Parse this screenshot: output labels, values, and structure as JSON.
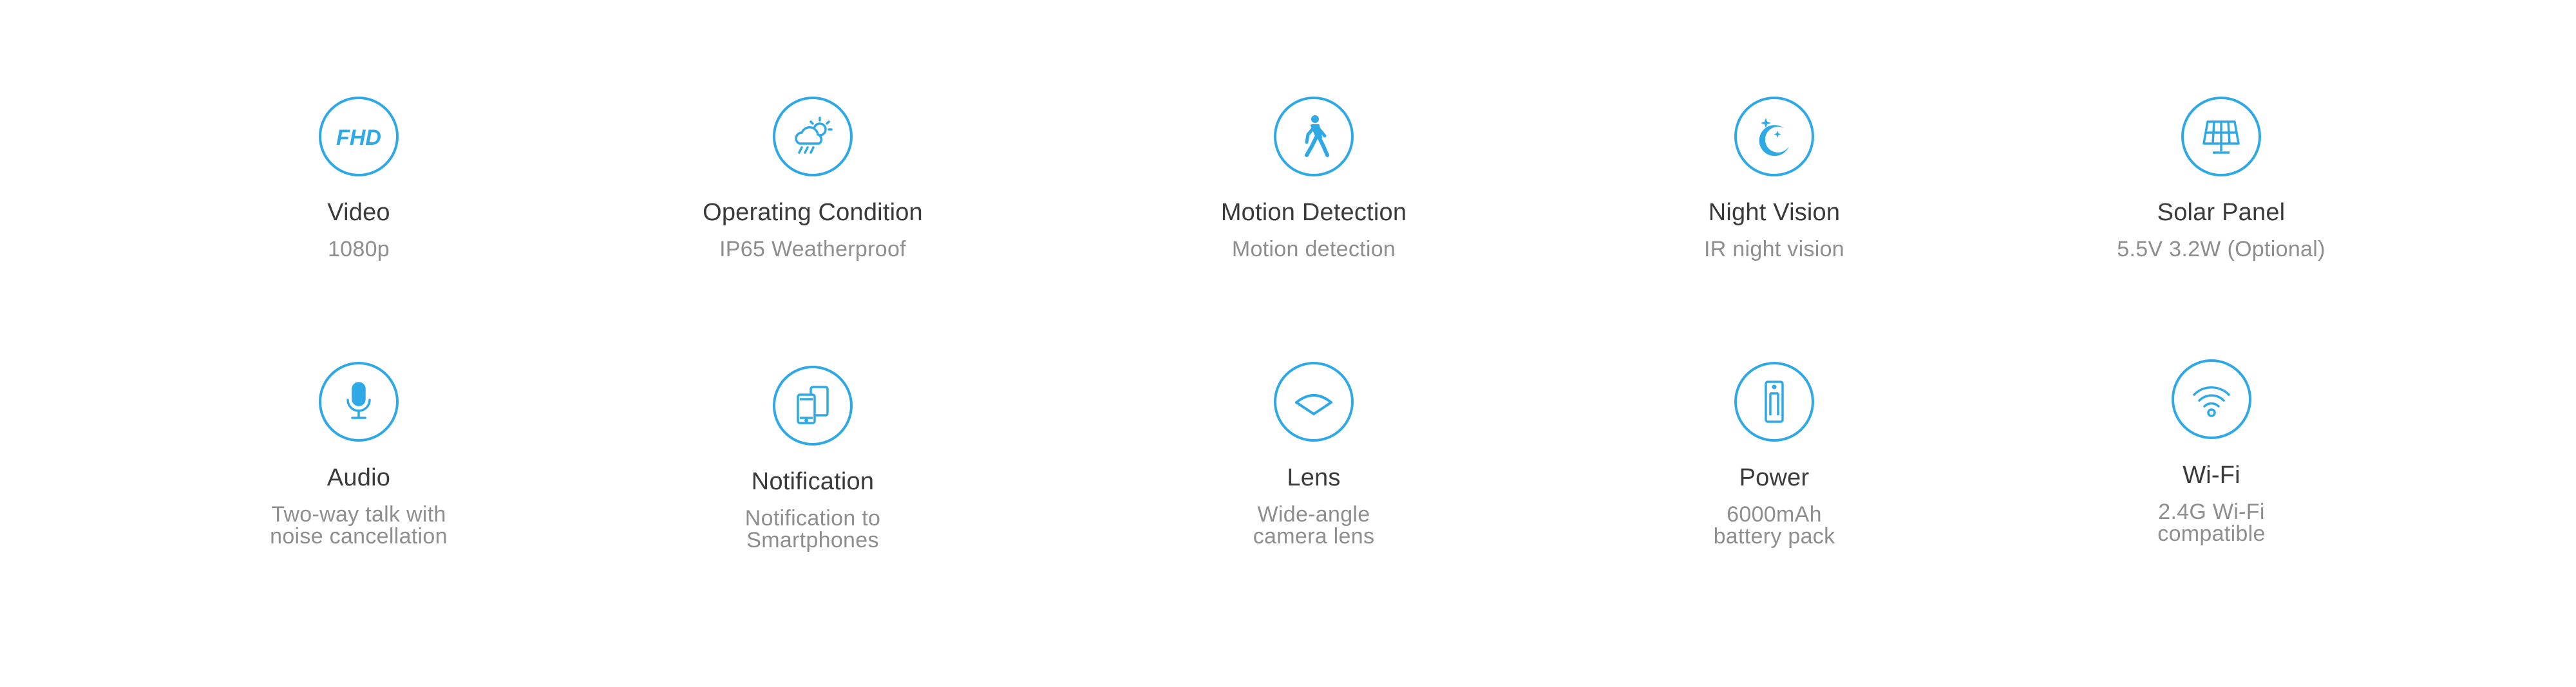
{
  "theme": {
    "accent": "#2fa9e6",
    "title_color": "#3a3a3a",
    "subtitle_color": "#8e8e8e"
  },
  "features": {
    "video": {
      "icon": "fhd-icon",
      "fhd_text": "FHD",
      "title": "Video",
      "subtitle": "1080p"
    },
    "operating": {
      "icon": "weather-icon",
      "title": "Operating Condition",
      "subtitle": "IP65 Weatherproof"
    },
    "motion": {
      "icon": "walking-person-icon",
      "title": "Motion Detection",
      "subtitle": "Motion detection"
    },
    "night": {
      "icon": "moon-stars-icon",
      "title": "Night Vision",
      "subtitle": "IR night vision"
    },
    "solar": {
      "icon": "solar-panel-icon",
      "title": "Solar Panel",
      "subtitle": "5.5V 3.2W (Optional)"
    },
    "audio": {
      "icon": "microphone-icon",
      "title": "Audio",
      "subtitle": "Two-way talk with\nnoise cancellation"
    },
    "notification": {
      "icon": "smartphones-icon",
      "title": "Notification",
      "subtitle": "Notification to\nSmartphones"
    },
    "lens": {
      "icon": "wide-angle-lens-icon",
      "title": "Lens",
      "subtitle": "Wide-angle\ncamera lens"
    },
    "power": {
      "icon": "battery-icon",
      "title": "Power",
      "subtitle": "6000mAh\nbattery pack"
    },
    "wifi": {
      "icon": "wifi-icon",
      "title": "Wi-Fi",
      "subtitle": "2.4G Wi-Fi\ncompatible"
    }
  }
}
